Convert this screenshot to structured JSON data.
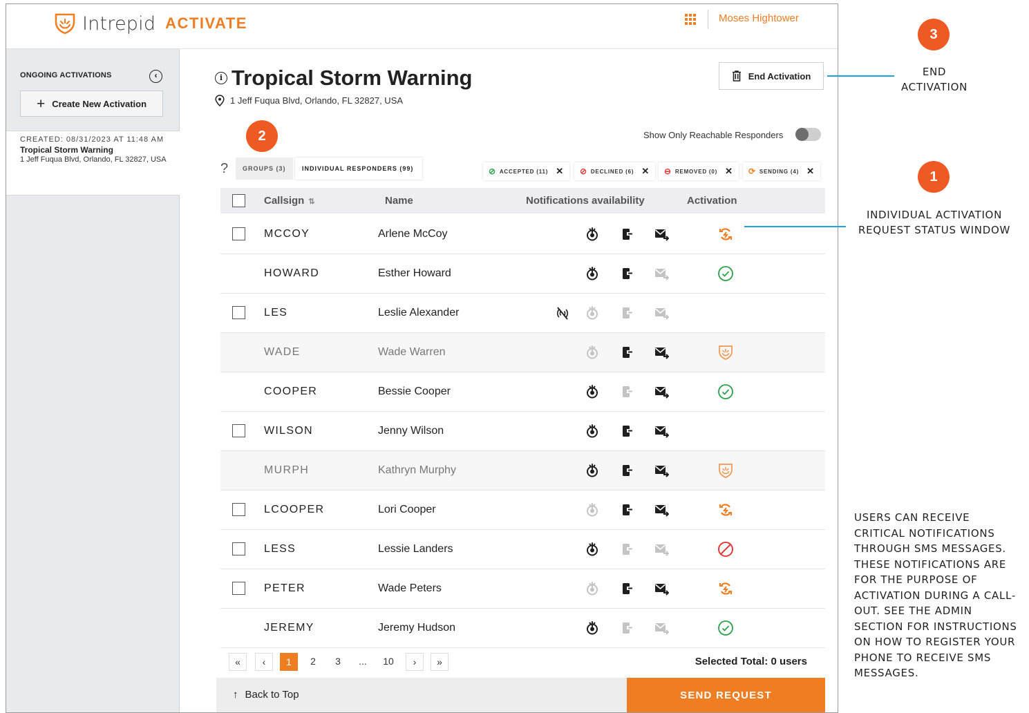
{
  "header": {
    "logo_text": "Intrepid",
    "logo_accent": "ACTIVATE",
    "user_name": "Moses Hightower"
  },
  "sidebar": {
    "heading": "ONGOING ACTIVATIONS",
    "collapse_glyph": "‹",
    "create_label": "Create New Activation",
    "card": {
      "created": "CREATED: 08/31/2023 AT 11:48 AM",
      "title": "Tropical Storm Warning",
      "address": "1 Jeff Fuqua Blvd, Orlando, FL 32827, USA"
    }
  },
  "main": {
    "title": "Tropical Storm Warning",
    "address": "1 Jeff Fuqua Blvd, Orlando, FL 32827, USA",
    "end_button": "End Activation",
    "toggle_label": "Show Only Reachable Responders",
    "toggle_on": false,
    "help_glyph": "?",
    "tabs": {
      "groups": "GROUPS (3)",
      "individual": "INDIVIDUAL RESPONDERS (99)"
    },
    "filters": {
      "accepted": "ACCEPTED (11)",
      "declined": "DECLINED (6)",
      "removed": "REMOVED (0)",
      "sending": "SENDING (4)"
    },
    "columns": {
      "callsign": "Callsign",
      "name": "Name",
      "notifications": "Notifications availability",
      "activation": "Activation"
    },
    "rows": [
      {
        "callsign": "MCCOY",
        "name": "Arlene McCoy",
        "checkbox": true,
        "muted": false,
        "nosignal": false,
        "push": true,
        "phone": true,
        "mail": true,
        "status": "sending"
      },
      {
        "callsign": "HOWARD",
        "name": "Esther Howard",
        "checkbox": false,
        "muted": false,
        "nosignal": false,
        "push": true,
        "phone": true,
        "mail": false,
        "status": "accepted"
      },
      {
        "callsign": "LES",
        "name": "Leslie Alexander",
        "checkbox": true,
        "muted": false,
        "nosignal": true,
        "push": false,
        "phone": false,
        "mail": false,
        "status": "none"
      },
      {
        "callsign": "WADE",
        "name": "Wade Warren",
        "checkbox": false,
        "muted": true,
        "nosignal": false,
        "push": false,
        "phone": true,
        "mail": true,
        "status": "shield"
      },
      {
        "callsign": "COOPER",
        "name": "Bessie Cooper",
        "checkbox": false,
        "muted": false,
        "nosignal": false,
        "push": true,
        "phone": false,
        "mail": true,
        "status": "accepted"
      },
      {
        "callsign": "WILSON",
        "name": "Jenny Wilson",
        "checkbox": true,
        "muted": false,
        "nosignal": false,
        "push": true,
        "phone": true,
        "mail": true,
        "status": "none"
      },
      {
        "callsign": "MURPH",
        "name": "Kathryn Murphy",
        "checkbox": false,
        "muted": true,
        "nosignal": false,
        "push": true,
        "phone": true,
        "mail": true,
        "status": "shield"
      },
      {
        "callsign": "LCOOPER",
        "name": "Lori Cooper",
        "checkbox": true,
        "muted": false,
        "nosignal": false,
        "push": false,
        "phone": true,
        "mail": true,
        "status": "sending"
      },
      {
        "callsign": "LESS",
        "name": "Lessie Landers",
        "checkbox": true,
        "muted": false,
        "nosignal": false,
        "push": true,
        "phone": false,
        "mail": false,
        "status": "declined"
      },
      {
        "callsign": "PETER",
        "name": "Wade Peters",
        "checkbox": true,
        "muted": false,
        "nosignal": false,
        "push": false,
        "phone": true,
        "mail": true,
        "status": "sending"
      },
      {
        "callsign": "JEREMY",
        "name": "Jeremy Hudson",
        "checkbox": false,
        "muted": false,
        "nosignal": false,
        "push": true,
        "phone": false,
        "mail": false,
        "status": "accepted"
      }
    ],
    "pagination": {
      "first": "«",
      "prev": "‹",
      "pages": [
        "1",
        "2",
        "3"
      ],
      "ellipsis": "...",
      "last_page": "10",
      "next": "›",
      "last": "»",
      "current": "1"
    },
    "selected_total": "Selected Total: 0 users",
    "back_to_top": "Back to Top",
    "send_request": "SEND REQUEST"
  },
  "annotations": {
    "callout_1": "1",
    "callout_2": "2",
    "callout_3": "3",
    "label_1": "INDIVIDUAL ACTIVATION REQUEST STATUS WINDOW",
    "label_3": "END ACTIVATION",
    "note": "USERS CAN RECEIVE CRITICAL NOTIFICATIONS THROUGH SMS MESSAGES. THESE NOTIFICATIONS ARE FOR THE PURPOSE OF ACTIVATION DURING A CALL-OUT. SEE THE ADMIN SECTION FOR INSTRUCTIONS ON HOW TO REGISTER YOUR PHONE TO RECEIVE SMS MESSAGES."
  },
  "colors": {
    "accent": "#ef7d22",
    "callout": "#ef5a24",
    "accepted": "#2aa24a",
    "declined": "#e23b3b",
    "annotation_line": "#1aa3dd"
  }
}
